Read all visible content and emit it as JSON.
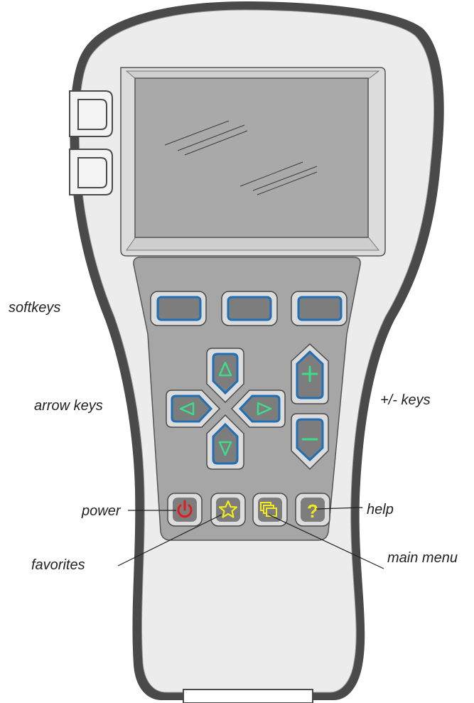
{
  "labels": {
    "softkeys": "softkeys",
    "arrow_keys": "arrow keys",
    "plus_minus_keys": "+/- keys",
    "power": "power",
    "help": "help",
    "favorites": "favorites",
    "main_menu": "main menu"
  },
  "colors": {
    "body_outline": "#4a4a4a",
    "body_fill": "#ececec",
    "screen_fill": "#a9a9a9",
    "keypad_fill": "#a6a6a6",
    "key_fill": "#7d7d7d",
    "key_stroke_blue": "#1f6fb6",
    "arrow_green": "#3ddc8a",
    "power_red": "#e01c1c",
    "icon_yellow": "#f2ea1d"
  },
  "icons": {
    "power_key": "power-icon",
    "favorites_key": "star-icon",
    "main_menu_key": "stacked-windows-icon",
    "help_key": "question-mark-icon"
  }
}
